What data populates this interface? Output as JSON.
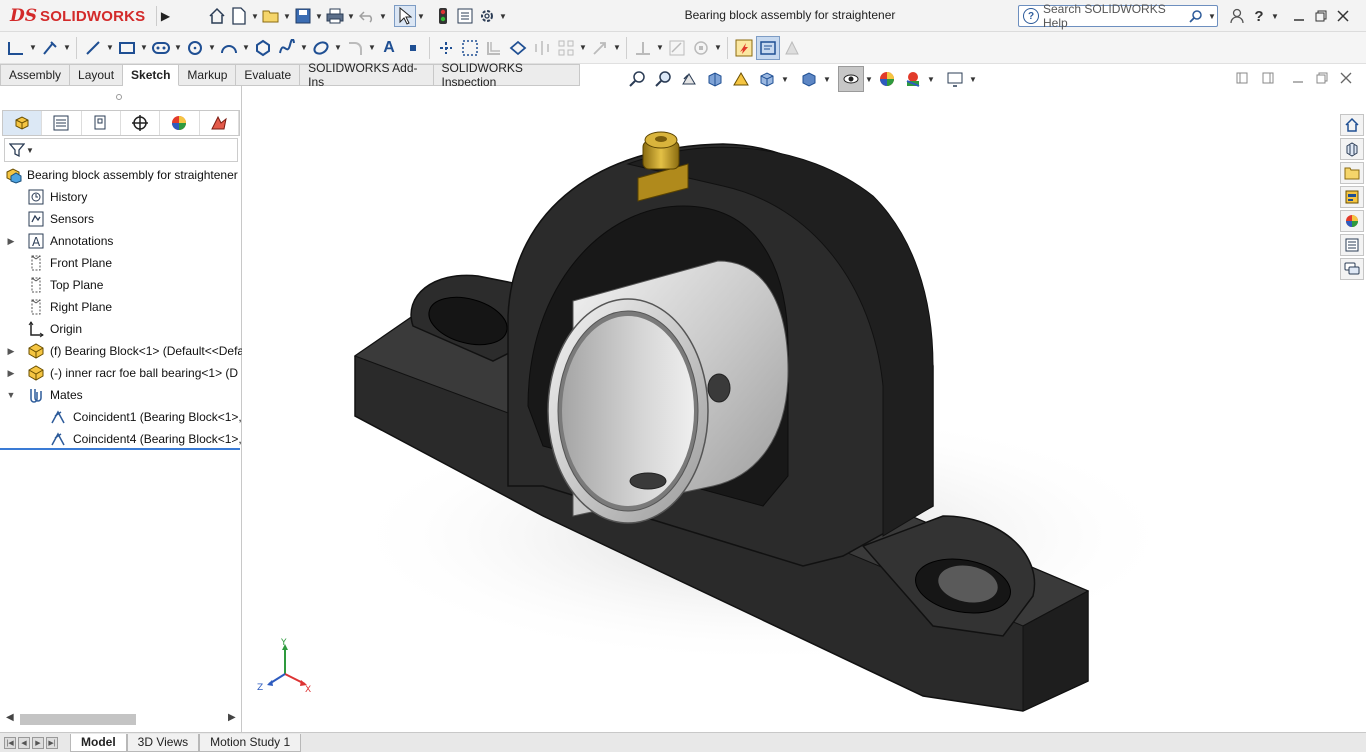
{
  "app": {
    "logo_prefix": "DS",
    "logo_name": "SOLIDWORKS"
  },
  "window": {
    "title": "Bearing block assembly for straightener"
  },
  "search": {
    "placeholder": "Search SOLIDWORKS Help"
  },
  "command_tabs": [
    {
      "label": "Assembly",
      "active": false
    },
    {
      "label": "Layout",
      "active": false
    },
    {
      "label": "Sketch",
      "active": true
    },
    {
      "label": "Markup",
      "active": false
    },
    {
      "label": "Evaluate",
      "active": false
    },
    {
      "label": "SOLIDWORKS Add-Ins",
      "active": false
    },
    {
      "label": "SOLIDWORKS Inspection",
      "active": false
    }
  ],
  "feature_tree": {
    "root": "Bearing block assembly for straightener",
    "items": [
      {
        "label": "History",
        "icon": "history-icon",
        "expandable": false,
        "level": 1
      },
      {
        "label": "Sensors",
        "icon": "sensors-icon",
        "expandable": false,
        "level": 1
      },
      {
        "label": "Annotations",
        "icon": "annotations-icon",
        "expandable": true,
        "level": 1
      },
      {
        "label": "Front Plane",
        "icon": "plane-icon",
        "expandable": false,
        "level": 1
      },
      {
        "label": "Top Plane",
        "icon": "plane-icon",
        "expandable": false,
        "level": 1
      },
      {
        "label": "Right Plane",
        "icon": "plane-icon",
        "expandable": false,
        "level": 1
      },
      {
        "label": "Origin",
        "icon": "origin-icon",
        "expandable": false,
        "level": 1
      },
      {
        "label": "(f) Bearing Block<1> (Default<<Defa",
        "icon": "part-icon",
        "expandable": true,
        "level": 1
      },
      {
        "label": "(-) inner racr foe ball bearing<1> (D",
        "icon": "part-icon",
        "expandable": true,
        "level": 1
      },
      {
        "label": "Mates",
        "icon": "mates-icon",
        "expandable": true,
        "expanded": true,
        "level": 1
      },
      {
        "label": "Coincident1 (Bearing Block<1>,",
        "icon": "coincident-icon",
        "expandable": false,
        "level": 2
      },
      {
        "label": "Coincident4 (Bearing Block<1>,",
        "icon": "coincident-icon",
        "expandable": false,
        "level": 2
      }
    ]
  },
  "triad": {
    "x": "X",
    "y": "Y",
    "z": "Z"
  },
  "bottom_tabs": [
    {
      "label": "Model",
      "active": true
    },
    {
      "label": "3D Views",
      "active": false
    },
    {
      "label": "Motion Study 1",
      "active": false
    }
  ],
  "colors": {
    "accent": "#3a7bd5",
    "brand": "#d32a2a",
    "part_black": "#262626",
    "bearing_silver": "#cfcfcf",
    "grease_fitting": "#c9a227"
  }
}
